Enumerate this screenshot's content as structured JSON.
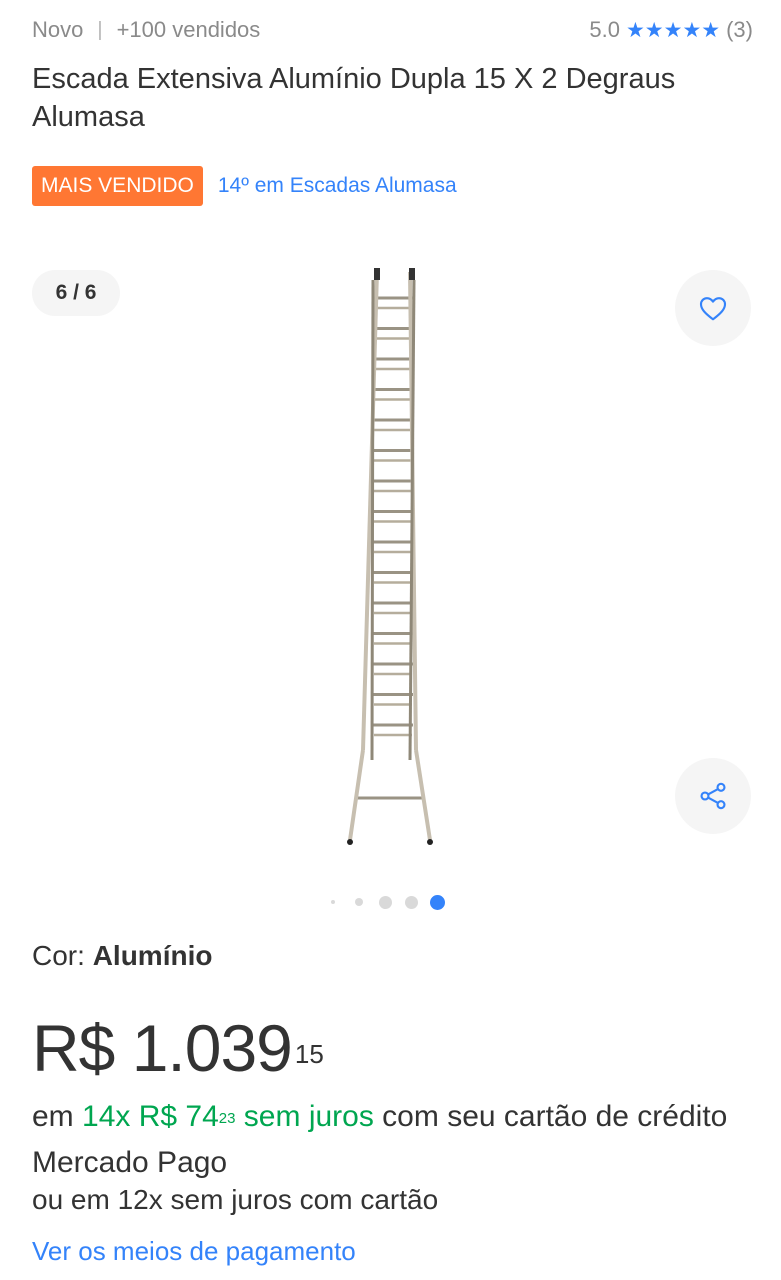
{
  "header": {
    "condition": "Novo",
    "separator": "|",
    "sold": "+100 vendidos",
    "rating": "5.0",
    "rating_stars": 5,
    "reviews": "(3)"
  },
  "product": {
    "title": "Escada Extensiva Alumínio Dupla 15 X 2 Degraus Alumasa",
    "badge": "MAIS VENDIDO",
    "ranking": "14º em Escadas Alumasa"
  },
  "gallery": {
    "counter": "6 / 6",
    "total": 6,
    "active_index": 6,
    "favorite_icon": "heart-icon",
    "share_icon": "share-icon"
  },
  "variant": {
    "label": "Cor: ",
    "value": "Alumínio"
  },
  "price": {
    "currency": "R$",
    "amount": "1.039",
    "cents": "15"
  },
  "installments": {
    "prefix": "em ",
    "count": "14x R$ 74",
    "cents": "23",
    "interest": " sem juros",
    "suffix": " com seu cartão de crédito Mercado Pago",
    "other": "ou em 12x sem juros com cartão",
    "link": "Ver os meios de pagamento"
  },
  "colors": {
    "accent": "#3483fa",
    "badge": "#ff7733",
    "green": "#00a650",
    "text": "#333333",
    "muted": "#8a8a8a"
  }
}
